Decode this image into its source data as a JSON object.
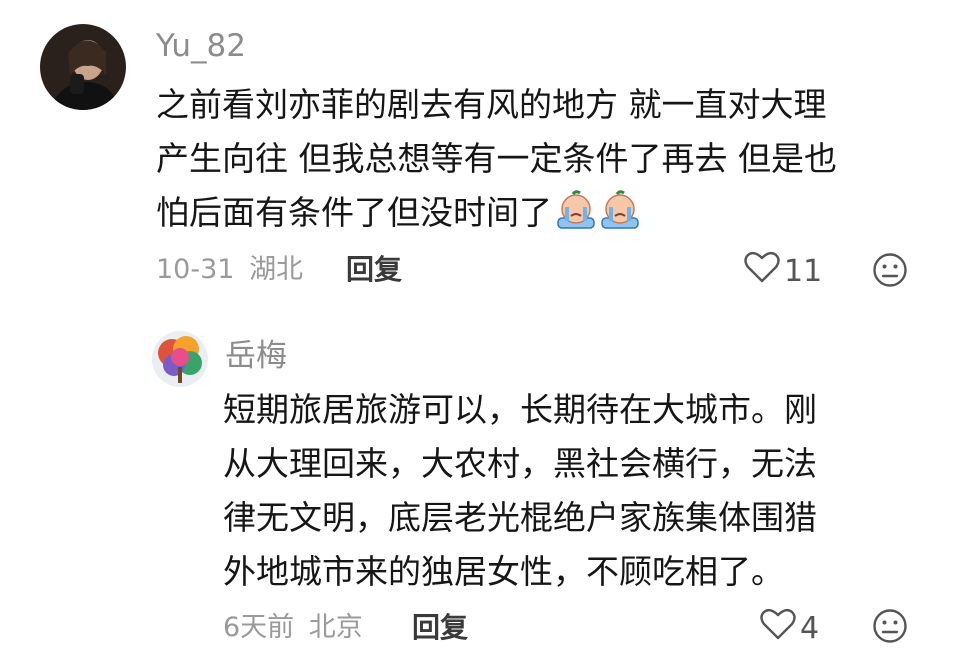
{
  "comments": [
    {
      "username": "Yu_82",
      "content_lines": [
        "之前看刘亦菲的剧去有风的地方 就一直对大理",
        "产生向往 但我总想等有一定条件了再去 但是也",
        "怕后面有条件了但没时间了"
      ],
      "emojis": [
        "crying-emoji",
        "crying-emoji"
      ],
      "date": "10-31",
      "location": "湖北",
      "reply_label": "回复",
      "likes": "11"
    },
    {
      "username": "岳梅",
      "content_lines": [
        "短期旅居旅游可以，长期待在大城市。刚",
        "从大理回来，大农村，黑社会横行，无法",
        "律无文明，底层老光棍绝户家族集体围猎",
        "外地城市来的独居女性，不顾吃相了。"
      ],
      "date": "6天前",
      "location": "北京",
      "reply_label": "回复",
      "likes": "4"
    }
  ],
  "colors": {
    "username": "#8c8c8c",
    "meta": "#9a9a9a",
    "text": "#161616"
  }
}
